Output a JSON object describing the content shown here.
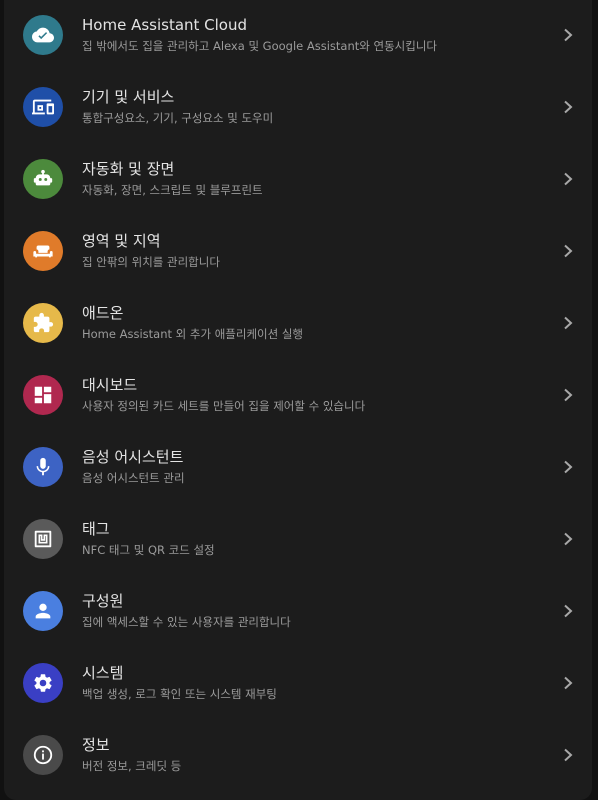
{
  "items": [
    {
      "title": "Home Assistant Cloud",
      "subtitle": "집 밖에서도 집을 관리하고 Alexa 및 Google Assistant와 연동시킵니다",
      "icon": "cloud-icon",
      "color": "#2f7a8c"
    },
    {
      "title": "기기 및 서비스",
      "subtitle": "통합구성요소, 기기, 구성요소 및 도우미",
      "icon": "devices-icon",
      "color": "#1f4fa8"
    },
    {
      "title": "자동화 및 장면",
      "subtitle": "자동화, 장면, 스크립트 및 블루프린트",
      "icon": "robot-icon",
      "color": "#4c8a3c"
    },
    {
      "title": "영역 및 지역",
      "subtitle": "집 안팎의 위치를 관리합니다",
      "icon": "sofa-icon",
      "color": "#e07b2a"
    },
    {
      "title": "애드온",
      "subtitle": "Home Assistant 외 추가 애플리케이션 실행",
      "icon": "puzzle-icon",
      "color": "#e6b94a"
    },
    {
      "title": "대시보드",
      "subtitle": "사용자 정의된 카드 세트를 만들어 집을 제어할 수 있습니다",
      "icon": "dashboard-icon",
      "color": "#b0284f"
    },
    {
      "title": "음성 어시스턴트",
      "subtitle": "음성 어시스턴트 관리",
      "icon": "microphone-icon",
      "color": "#3d63c4"
    },
    {
      "title": "태그",
      "subtitle": "NFC 태그 및 QR 코드 설정",
      "icon": "nfc-tag-icon",
      "color": "#5a5a5a"
    },
    {
      "title": "구성원",
      "subtitle": "집에 액세스할 수 있는 사용자를 관리합니다",
      "icon": "person-icon",
      "color": "#4a7fe0"
    },
    {
      "title": "시스템",
      "subtitle": "백업 생성, 로그 확인 또는 시스템 재부팅",
      "icon": "gear-icon",
      "color": "#3a3fc4"
    },
    {
      "title": "정보",
      "subtitle": "버전 정보, 크레딧 등",
      "icon": "info-icon",
      "color": "#4a4a4a"
    }
  ]
}
